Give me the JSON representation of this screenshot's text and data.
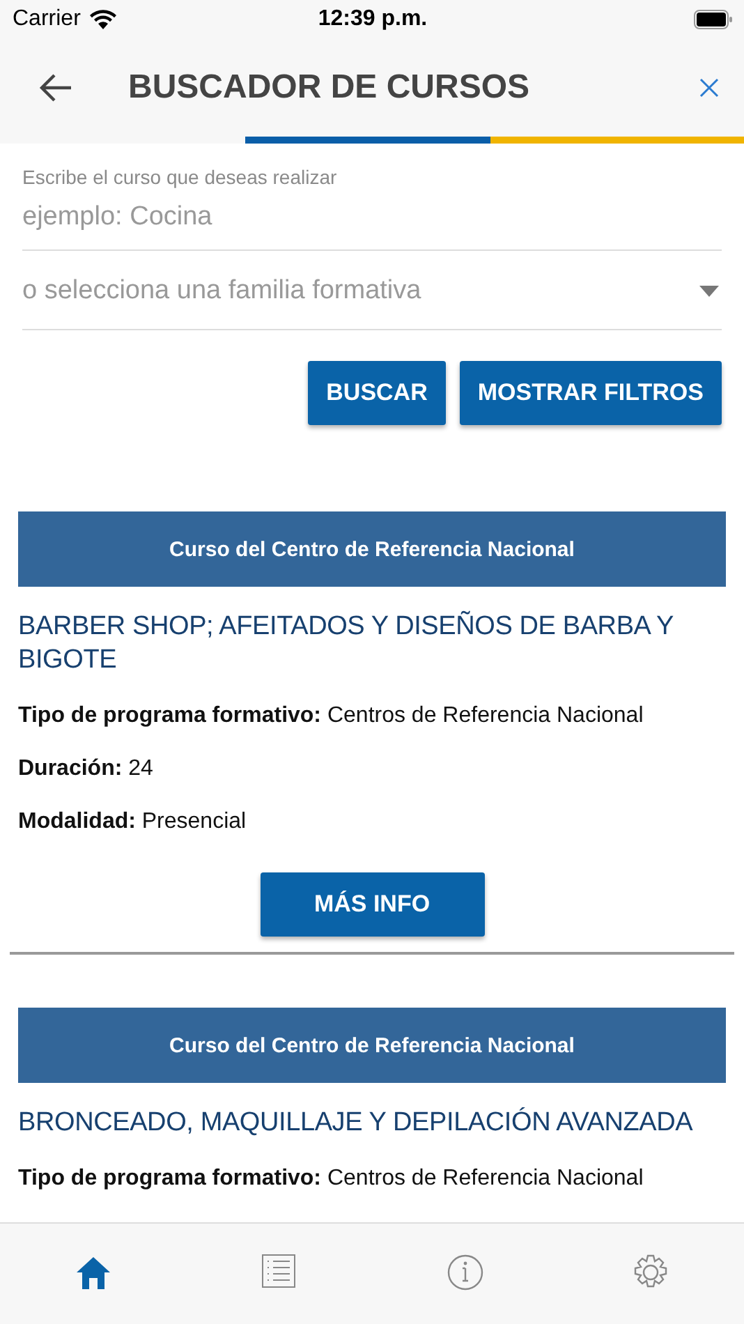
{
  "status_bar": {
    "carrier": "Carrier",
    "time": "12:39 p.m."
  },
  "header": {
    "title": "BUSCADOR DE CURSOS"
  },
  "search": {
    "label": "Escribe el curso que deseas realizar",
    "placeholder": "ejemplo: Cocina"
  },
  "family_select": {
    "placeholder": "o selecciona una familia formativa"
  },
  "buttons": [
    "BUSCAR",
    "MOSTRAR FILTROS"
  ],
  "courses": [
    {
      "banner": "Curso del Centro de Referencia Nacional",
      "title": "BARBER SHOP; AFEITADOS Y DISEÑOS DE BARBA Y BIGOTE",
      "details": [
        "**Tipo de programa formativo:** Centros de Referencia Nacional",
        "**Duración:** 24",
        "**Modalidad:** Presencial"
      ],
      "button": "MÁS INFO"
    },
    {
      "banner": "Curso del Centro de Referencia Nacional",
      "title": "BRONCEADO, MAQUILLAJE Y DEPILACIÓN AVANZADA",
      "details": [
        "**Tipo de programa formativo:** Centros de Referencia Nacional"
      ]
    }
  ],
  "tab_bar": [
    {
      "kind": "home",
      "selected": true
    },
    {
      "kind": "list",
      "selected": false
    },
    {
      "kind": "info",
      "selected": false
    },
    {
      "kind": "settings",
      "selected": false
    }
  ]
}
